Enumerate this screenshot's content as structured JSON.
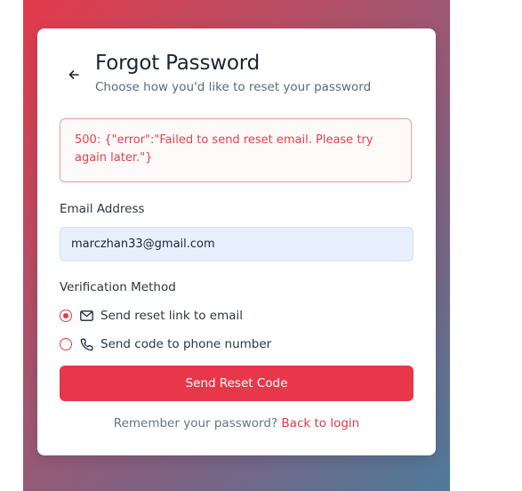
{
  "header": {
    "title": "Forgot Password",
    "subtitle": "Choose how you'd like to reset your password",
    "back_icon": "arrow-left-icon"
  },
  "error": {
    "message": "500: {\"error\":\"Failed to send reset email. Please try again later.\"}"
  },
  "email": {
    "label": "Email Address",
    "value": "marczhan33@gmail.com"
  },
  "verification": {
    "label": "Verification Method",
    "options": [
      {
        "label": "Send reset link to email",
        "icon": "mail-icon",
        "selected": true
      },
      {
        "label": "Send code to phone number",
        "icon": "phone-icon",
        "selected": false
      }
    ]
  },
  "submit": {
    "label": "Send Reset Code"
  },
  "footer": {
    "prompt": "Remember your password?",
    "link": "Back to login"
  },
  "colors": {
    "accent": "#e8374a",
    "error_text": "#e0424b",
    "input_bg": "#e8f0fd"
  }
}
